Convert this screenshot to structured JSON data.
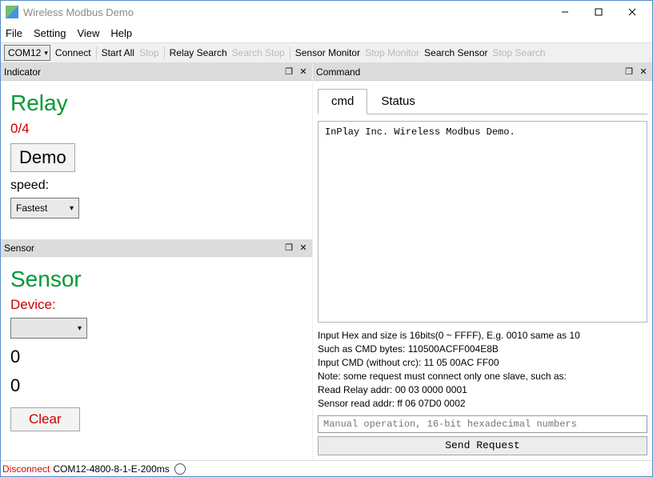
{
  "window": {
    "title": "Wireless Modbus Demo"
  },
  "menu": {
    "file": "File",
    "setting": "Setting",
    "view": "View",
    "help": "Help"
  },
  "toolbar": {
    "port": "COM12",
    "connect": "Connect",
    "startall": "Start All",
    "stop": "Stop",
    "relaysearch": "Relay Search",
    "searchstop": "Search Stop",
    "sensormonitor": "Sensor Monitor",
    "stopmonitor": "Stop Monitor",
    "searchsensor": "Search Sensor",
    "stopsearch": "Stop Search"
  },
  "indicator": {
    "header": "Indicator",
    "relay_title": "Relay",
    "count": "0/4",
    "demo_btn": "Demo",
    "speed_lbl": "speed:",
    "speed_val": "Fastest"
  },
  "sensor": {
    "header": "Sensor",
    "title": "Sensor",
    "device_lbl": "Device:",
    "device_val": "",
    "val1": "0",
    "val2": "0",
    "clear": "Clear"
  },
  "command": {
    "header": "Command",
    "tab_cmd": "cmd",
    "tab_status": "Status",
    "log": "InPlay Inc. Wireless Modbus Demo.",
    "help1": "Input Hex and size is 16bits(0 ~ FFFF), E.g. 0010 same as 10",
    "help2": "Such as CMD bytes: 110500ACFF004E8B",
    "help3": "Input CMD (without crc): 11 05 00AC FF00",
    "help4": "Note: some request must connect only one slave, such as:",
    "help5": "Read Relay addr: 00 03 0000 0001",
    "help6": "Sensor read addr: ff 06 07D0 0002",
    "input_placeholder": "Manual operation, 16-bit hexadecimal numbers",
    "send": "Send Request"
  },
  "status": {
    "disconnect": "Disconnect",
    "conn": "COM12-4800-8-1-E-200ms"
  }
}
